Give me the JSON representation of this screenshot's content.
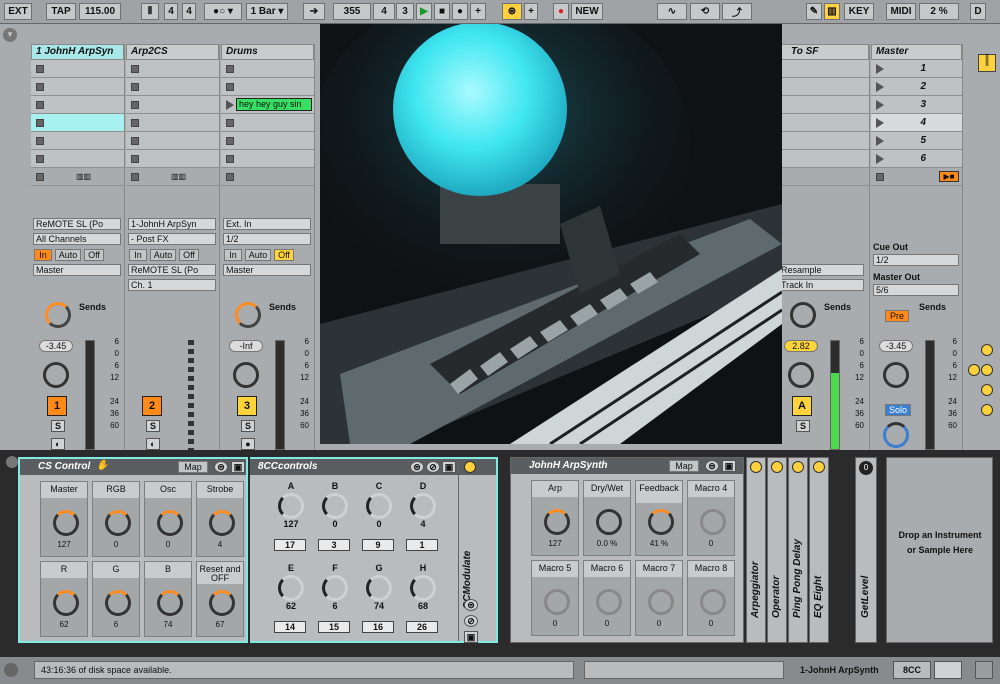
{
  "topbar": {
    "ext": "EXT",
    "tap": "TAP",
    "tempo": "115.00",
    "sig_num": "4",
    "sig_den": "4",
    "quant": "1 Bar",
    "pos_bar": "355",
    "pos_beat": "4",
    "pos_sixteenth": "3",
    "new_label": "NEW",
    "key_label": "KEY",
    "midi_label": "MIDI",
    "cpu": "2 %",
    "d_label": "D"
  },
  "tracks": [
    {
      "name": "1 JohnH ArpSyn",
      "input": "ReMOTE SL (Po",
      "channel": "All Channels",
      "output": "Master",
      "vol": "-3.45",
      "num": "1",
      "sends": "Sends"
    },
    {
      "name": "Arp2CS",
      "input": "1-JohnH ArpSyn",
      "channel": "- Post FX",
      "output": "ReMOTE SL (Po",
      "chsel": "Ch. 1",
      "num": "2"
    },
    {
      "name": "Drums",
      "input": "Ext. In",
      "channel": "1/2",
      "output": "Master",
      "vol": "-Inf",
      "num": "3",
      "sends": "Sends",
      "clip": "hey hey guy sin"
    },
    {
      "name": "To SF",
      "output": "Resample",
      "chsel": "Track In",
      "vol": "2.82",
      "num": "A",
      "sends": "Sends"
    },
    {
      "name": "Master",
      "cue_out": "Cue Out",
      "cue_val": "1/2",
      "master_out": "Master Out",
      "master_val": "5/6",
      "vol": "-3.45",
      "pre": "Pre",
      "solo": "Solo",
      "sends": "Sends"
    }
  ],
  "scenes": [
    "1",
    "2",
    "3",
    "4",
    "5",
    "6"
  ],
  "io_buttons": {
    "in": "In",
    "auto": "Auto",
    "off": "Off"
  },
  "meter_scale": [
    "6",
    "0",
    "6",
    "12",
    "24",
    "36",
    "60"
  ],
  "devices": {
    "cs": {
      "title": "CS Control",
      "map": "Map",
      "macros": [
        {
          "name": "Master",
          "value": "127"
        },
        {
          "name": "RGB",
          "value": "0"
        },
        {
          "name": "Osc",
          "value": "0"
        },
        {
          "name": "Strobe",
          "value": "4"
        },
        {
          "name": "R",
          "value": "62"
        },
        {
          "name": "G",
          "value": "6"
        },
        {
          "name": "B",
          "value": "74"
        },
        {
          "name": "Reset and OFF",
          "value": "67"
        }
      ]
    },
    "cc": {
      "title": "8CCcontrols",
      "knobs": [
        {
          "name": "A",
          "value": "127",
          "box": "17"
        },
        {
          "name": "B",
          "value": "0",
          "box": "3"
        },
        {
          "name": "C",
          "value": "0",
          "box": "9"
        },
        {
          "name": "D",
          "value": "4",
          "box": "1"
        },
        {
          "name": "E",
          "value": "62",
          "box": "14"
        },
        {
          "name": "F",
          "value": "6",
          "box": "15"
        },
        {
          "name": "G",
          "value": "74",
          "box": "16"
        },
        {
          "name": "H",
          "value": "68",
          "box": "26"
        }
      ],
      "modulate": "CCModulate"
    },
    "arp": {
      "title": "JohnH ArpSynth",
      "map": "Map",
      "macros": [
        {
          "name": "Arp",
          "value": "127"
        },
        {
          "name": "Dry/Wet",
          "value": "0.0 %"
        },
        {
          "name": "Feedback",
          "value": "41 %"
        },
        {
          "name": "Macro 4",
          "value": "0"
        },
        {
          "name": "Macro 5",
          "value": "0"
        },
        {
          "name": "Macro 6",
          "value": "0"
        },
        {
          "name": "Macro 7",
          "value": "0"
        },
        {
          "name": "Macro 8",
          "value": "0"
        }
      ]
    },
    "chain": [
      "Arpeggiator",
      "Operator",
      "Ping Pong Delay",
      "EQ Eight"
    ],
    "getlevel": "GetLevel",
    "drop": "Drop an Instrument or Sample Here"
  },
  "status": {
    "message": "43:16:36 of disk space available.",
    "track_name": "1-JohnH ArpSynth",
    "tab": "8CC"
  },
  "colors": {
    "accent": "#ff8c22",
    "clip": "#37e063",
    "selected": "#a9f0f0"
  }
}
